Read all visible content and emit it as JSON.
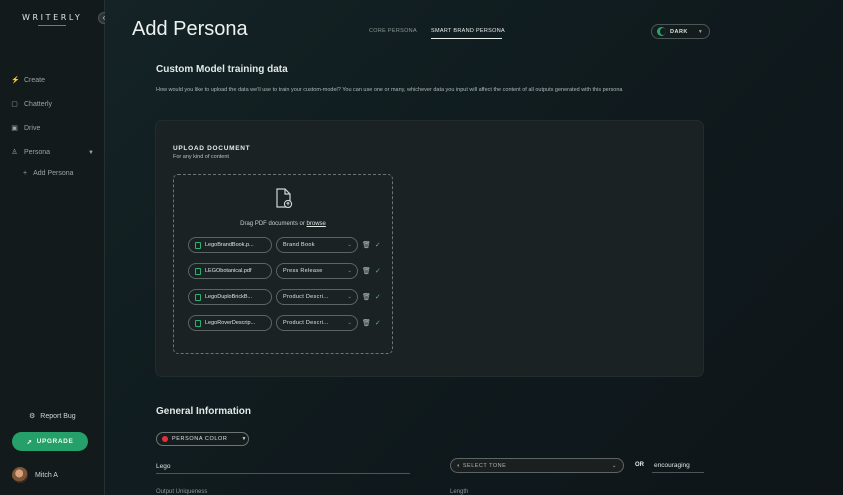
{
  "app": {
    "name": "WRITERLY"
  },
  "sidebar": {
    "items": [
      {
        "label": "Create",
        "icon": "wand-icon"
      },
      {
        "label": "Chatterly",
        "icon": "chat-icon"
      },
      {
        "label": "Drive",
        "icon": "drive-icon"
      },
      {
        "label": "Persona",
        "icon": "persona-icon"
      }
    ],
    "sub_item": "Add Persona",
    "report_bug": "Report Bug",
    "upgrade": "UPGRADE",
    "user_name": "Mitch A"
  },
  "header": {
    "title": "Add Persona",
    "tabs": [
      {
        "label": "CORE PERSONA",
        "active": false
      },
      {
        "label": "SMART BRAND PERSONA",
        "active": true
      }
    ],
    "theme": "DARK"
  },
  "training": {
    "title": "Custom Model training data",
    "description": "How would you like to upload the data we'll use to train your custom-model? You can use one or many, whichever data you input will affect the content of all outputs generated with this persona",
    "upload_title": "UPLOAD DOCUMENT",
    "upload_subtitle": "For any kind of content",
    "drop_text": "Drag PDF documents or",
    "drop_link": "browse",
    "files": [
      {
        "name": "LegoBrandBook.p...",
        "type": "Brand Book"
      },
      {
        "name": "LEGObotanical.pdf",
        "type": "Press Release"
      },
      {
        "name": "LegoDuploBrickB...",
        "type": "Product Descri..."
      },
      {
        "name": "LegoRoverDescrip...",
        "type": "Product Descri..."
      }
    ]
  },
  "general": {
    "title": "General Information",
    "persona_color_label": "PERSONA COLOR",
    "persona_color": "#e53038",
    "name_value": "Lego",
    "tone_placeholder": "SELECT TONE",
    "or_label": "OR",
    "tone_value": "encouraging",
    "next_labels": [
      "Output Uniqueness",
      "Length"
    ]
  },
  "colors": {
    "accent": "#26a06a",
    "background": "#0f1a1b"
  }
}
